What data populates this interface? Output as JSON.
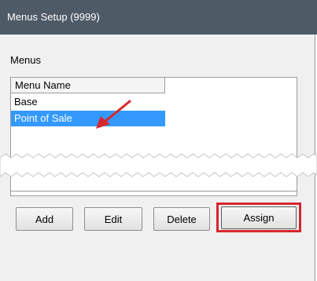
{
  "window": {
    "title": "Menus Setup (9999)"
  },
  "menus": {
    "section_label": "Menus",
    "column_header": "Menu Name",
    "rows": [
      "Base",
      "Point of Sale"
    ],
    "selected_index": 1
  },
  "buttons": {
    "add_label": "Add",
    "edit_label": "Edit",
    "delete_label": "Delete",
    "assign_label": "Assign"
  },
  "colors": {
    "selection": "#3399ff",
    "highlight_box": "#d7262e",
    "pointer_arrow": "#d7262e",
    "titlebar": "#4f5a67"
  }
}
